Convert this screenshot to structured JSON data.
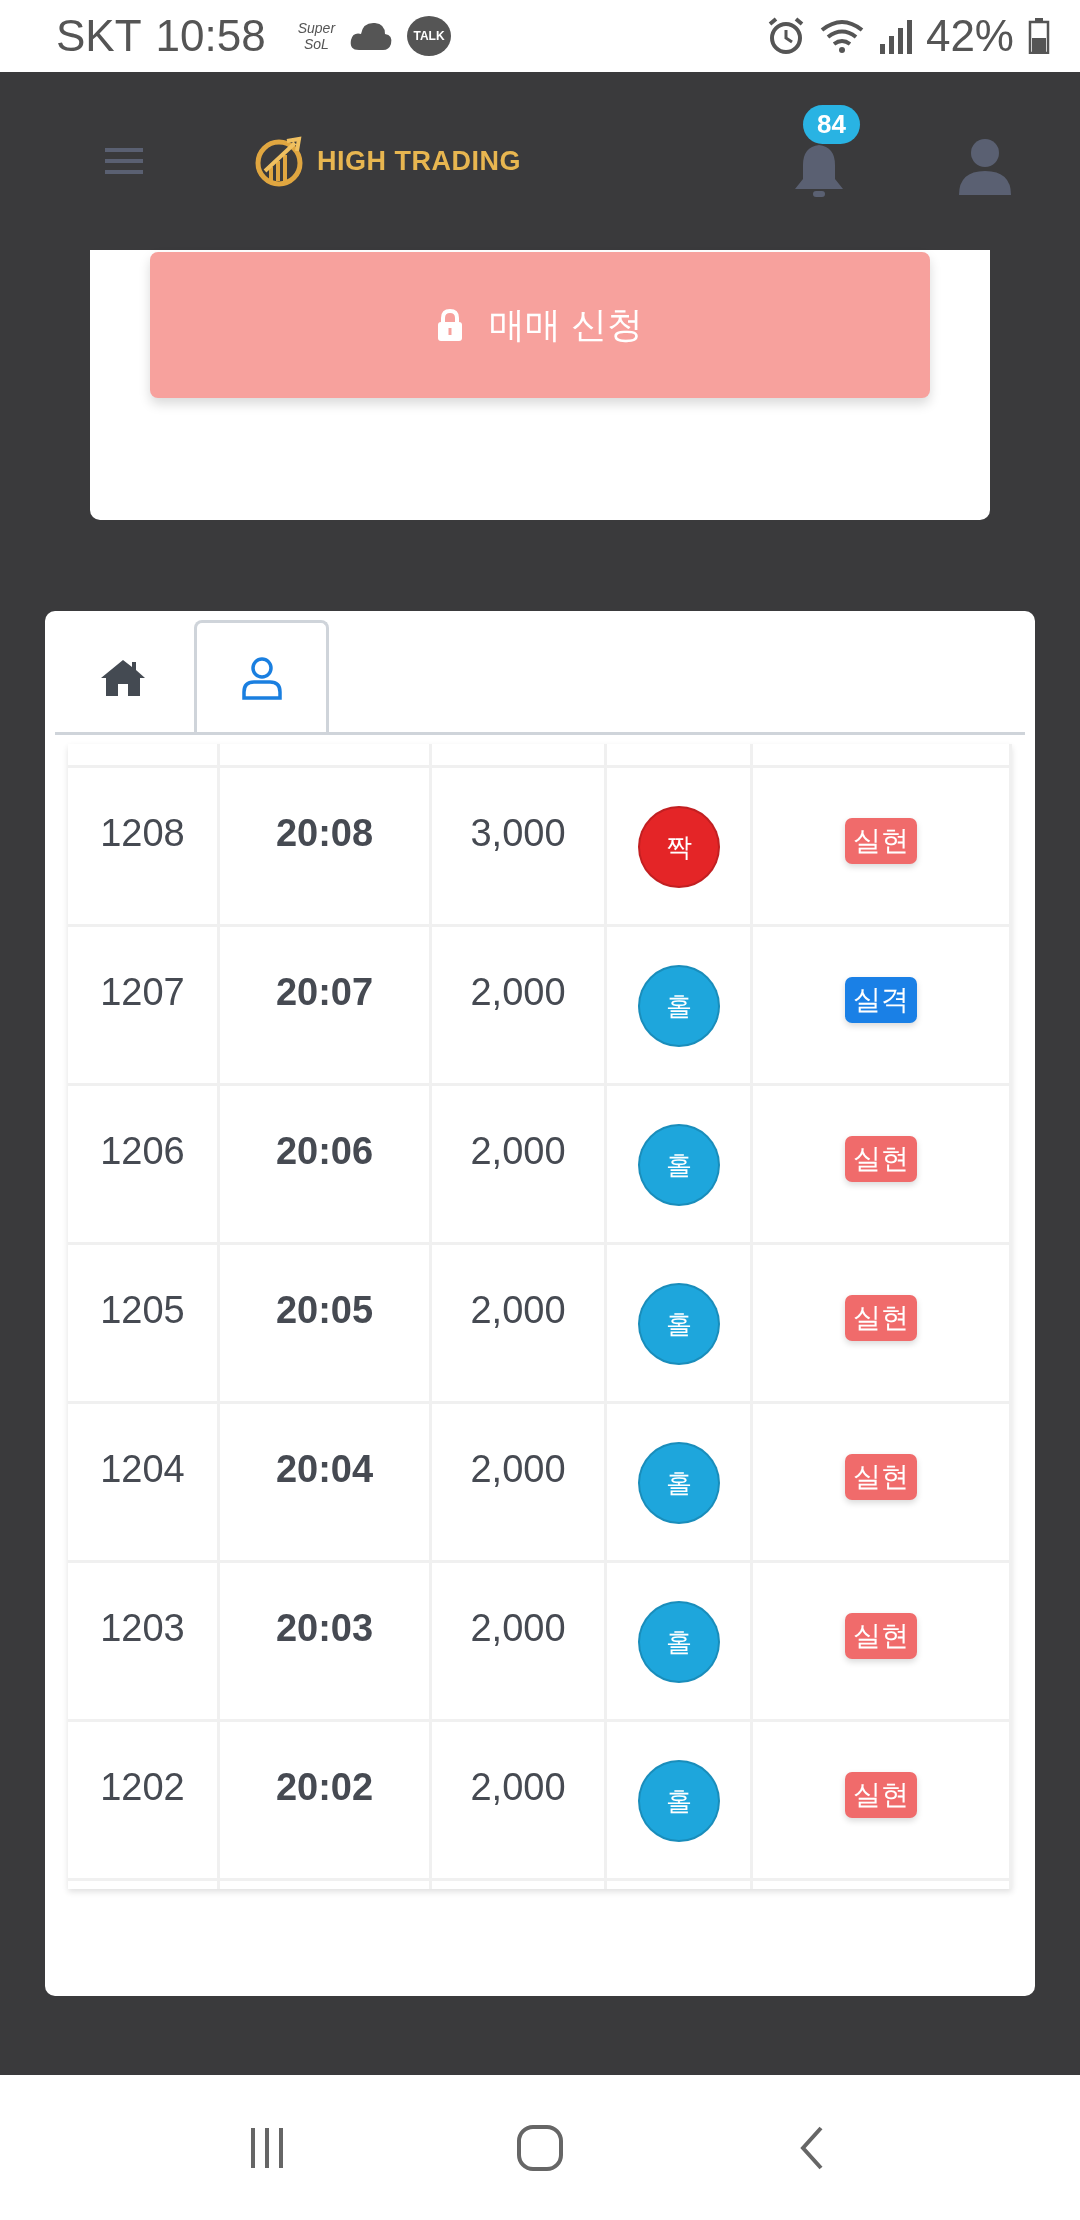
{
  "status_bar": {
    "carrier": "SKT",
    "time": "10:58",
    "app_icon_top": "Super",
    "app_icon_bottom": "SoL",
    "chat_icon": "TALK",
    "battery": "42%"
  },
  "header": {
    "logo": "HIGH TRADING",
    "notification_count": "84"
  },
  "order_button": {
    "label": "매매 신청"
  },
  "tabs": [
    {
      "kind": "home",
      "selected": false
    },
    {
      "kind": "person",
      "selected": true
    }
  ],
  "rows": [
    {
      "round": "1208",
      "time": "20:08",
      "amount": "3,000",
      "ball": {
        "label": "짝",
        "color": "#e42527"
      },
      "result": {
        "label": "실현",
        "color": "#f06b6b"
      }
    },
    {
      "round": "1207",
      "time": "20:07",
      "amount": "2,000",
      "ball": {
        "label": "홀",
        "color": "#1ea6dc"
      },
      "result": {
        "label": "실격",
        "color": "#1a80e6"
      }
    },
    {
      "round": "1206",
      "time": "20:06",
      "amount": "2,000",
      "ball": {
        "label": "홀",
        "color": "#1ea6dc"
      },
      "result": {
        "label": "실현",
        "color": "#f06b6b"
      }
    },
    {
      "round": "1205",
      "time": "20:05",
      "amount": "2,000",
      "ball": {
        "label": "홀",
        "color": "#1ea6dc"
      },
      "result": {
        "label": "실현",
        "color": "#f06b6b"
      }
    },
    {
      "round": "1204",
      "time": "20:04",
      "amount": "2,000",
      "ball": {
        "label": "홀",
        "color": "#1ea6dc"
      },
      "result": {
        "label": "실현",
        "color": "#f06b6b"
      }
    },
    {
      "round": "1203",
      "time": "20:03",
      "amount": "2,000",
      "ball": {
        "label": "홀",
        "color": "#1ea6dc"
      },
      "result": {
        "label": "실현",
        "color": "#f06b6b"
      }
    },
    {
      "round": "1202",
      "time": "20:02",
      "amount": "2,000",
      "ball": {
        "label": "홀",
        "color": "#1ea6dc"
      },
      "result": {
        "label": "실현",
        "color": "#f06b6b"
      }
    }
  ]
}
